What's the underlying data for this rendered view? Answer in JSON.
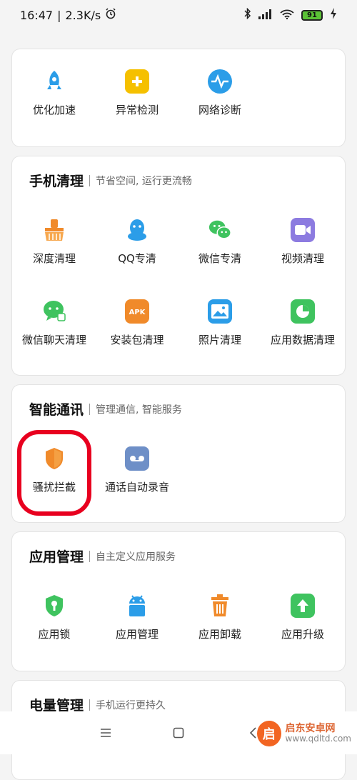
{
  "status": {
    "time": "16:47",
    "net_speed": "2.3K/s",
    "battery": "91",
    "icons": [
      "alarm-icon",
      "bluetooth-icon",
      "signal-icon",
      "wifi-icon",
      "battery-icon",
      "charging-icon"
    ]
  },
  "cards": {
    "top": {
      "items": [
        {
          "label": "优化加速",
          "icon": "rocket-icon",
          "color": "#2b9de8"
        },
        {
          "label": "异常检测",
          "icon": "medical-kit-icon",
          "color": "#f5c000"
        },
        {
          "label": "网络诊断",
          "icon": "pulse-icon",
          "color": "#2b9de8"
        }
      ]
    },
    "clean": {
      "title": "手机清理",
      "subtitle": "节省空间, 运行更流畅",
      "items": [
        {
          "label": "深度清理",
          "icon": "broom-icon",
          "color": "#f08a2a"
        },
        {
          "label": "QQ专清",
          "icon": "qq-icon",
          "color": "#2b9de8"
        },
        {
          "label": "微信专清",
          "icon": "wechat-icon",
          "color": "#3fc35f"
        },
        {
          "label": "视频清理",
          "icon": "video-icon",
          "color": "#8c7be0"
        },
        {
          "label": "微信聊天清理",
          "icon": "chat-bubble-icon",
          "color": "#3fc35f"
        },
        {
          "label": "安装包清理",
          "icon": "apk-box-icon",
          "color": "#f08a2a"
        },
        {
          "label": "照片清理",
          "icon": "photo-icon",
          "color": "#2b9de8"
        },
        {
          "label": "应用数据清理",
          "icon": "pie-chart-icon",
          "color": "#3fc35f"
        }
      ]
    },
    "comm": {
      "title": "智能通讯",
      "subtitle": "管理通信, 智能服务",
      "items": [
        {
          "label": "骚扰拦截",
          "icon": "shield-icon",
          "color": "#f08a2a"
        },
        {
          "label": "通话自动录音",
          "icon": "recorder-icon",
          "color": "#6e8fc7"
        }
      ]
    },
    "apps": {
      "title": "应用管理",
      "subtitle": "自主定义应用服务",
      "items": [
        {
          "label": "应用锁",
          "icon": "lock-shield-icon",
          "color": "#3fc35f"
        },
        {
          "label": "应用管理",
          "icon": "android-icon",
          "color": "#2b9de8"
        },
        {
          "label": "应用卸载",
          "icon": "trash-icon",
          "color": "#f08a2a"
        },
        {
          "label": "应用升级",
          "icon": "upgrade-arrow-icon",
          "color": "#3fc35f"
        }
      ]
    },
    "power": {
      "title": "电量管理",
      "subtitle": "手机运行更持久"
    }
  },
  "watermark": {
    "line1": "启东安卓网",
    "line2": "www.qdltd.com"
  }
}
